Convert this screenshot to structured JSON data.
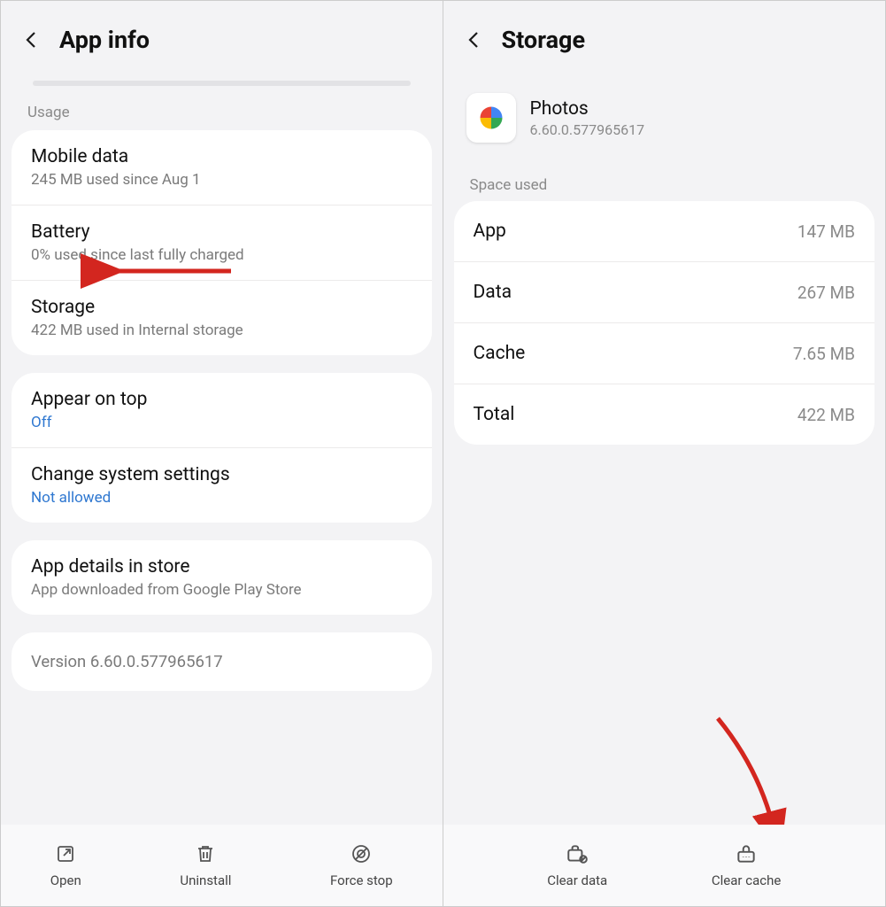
{
  "left": {
    "title": "App info",
    "section_usage": "Usage",
    "rows": {
      "mobile_data": {
        "title": "Mobile data",
        "sub": "245 MB used since Aug 1"
      },
      "battery": {
        "title": "Battery",
        "sub": "0% used since last fully charged"
      },
      "storage": {
        "title": "Storage",
        "sub": "422 MB used in Internal storage"
      },
      "appear": {
        "title": "Appear on top",
        "sub": "Off"
      },
      "change": {
        "title": "Change system settings",
        "sub": "Not allowed"
      },
      "details": {
        "title": "App details in store",
        "sub": "App downloaded from Google Play Store"
      }
    },
    "version": "Version 6.60.0.577965617",
    "bottom": {
      "open": "Open",
      "uninstall": "Uninstall",
      "forcestop": "Force stop"
    }
  },
  "right": {
    "title": "Storage",
    "app": {
      "name": "Photos",
      "version": "6.60.0.577965617"
    },
    "section_space": "Space used",
    "rows": {
      "app": {
        "label": "App",
        "value": "147 MB"
      },
      "data": {
        "label": "Data",
        "value": "267 MB"
      },
      "cache": {
        "label": "Cache",
        "value": "7.65 MB"
      },
      "total": {
        "label": "Total",
        "value": "422 MB"
      }
    },
    "bottom": {
      "cleardata": "Clear data",
      "clearcache": "Clear cache"
    }
  },
  "annotations": {
    "arrow1_target": "Battery row",
    "arrow2_target": "Clear cache button",
    "arrow_color": "#d3261f"
  }
}
